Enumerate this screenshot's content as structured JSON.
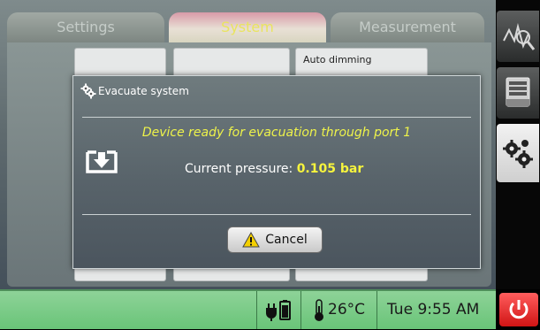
{
  "tabs": [
    {
      "label": "Settings"
    },
    {
      "label": "System"
    },
    {
      "label": "Measurement"
    }
  ],
  "background_panel": {
    "auto_dimming_label": "Auto dimming"
  },
  "dialog": {
    "title": "Evacuate system",
    "message": "Device ready for evacuation through port 1",
    "pressure_label": "Current pressure:",
    "pressure_value": "0.105 bar",
    "cancel_label": "Cancel"
  },
  "status_bar": {
    "temperature": "26°C",
    "datetime": "Tue 9:55 AM"
  },
  "colors": {
    "accent_yellow": "#eef34a",
    "status_green": "#7ccb88",
    "power_red": "#e02020"
  },
  "icons": {
    "nav": [
      "measurement-icon",
      "storage-tray-icon",
      "gears-icon"
    ],
    "status": [
      "battery-plug-icon",
      "thermometer-icon"
    ],
    "power": "power-icon"
  }
}
